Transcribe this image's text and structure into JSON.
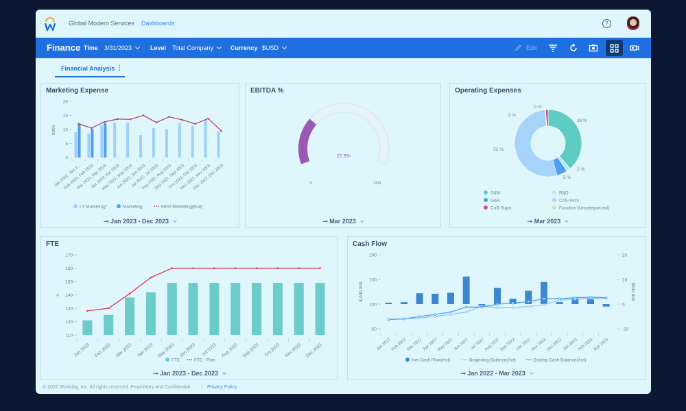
{
  "header": {
    "org": "Global Modern Services",
    "breadcrumb": "Dashboards",
    "help_icon": "?",
    "avatar": "user-avatar"
  },
  "toolbar": {
    "title": "Finance",
    "time_label": "Time",
    "time_value": "3/31/2023",
    "level_label": "Level",
    "level_value": "Total Company",
    "currency_label": "Currency",
    "currency_value": "$USD",
    "edit_label": "Edit",
    "icons": [
      "edit-icon",
      "filter-icon",
      "refresh-icon",
      "camera-icon",
      "grid-view-icon",
      "video-icon"
    ]
  },
  "tabs": [
    {
      "label": "Financial Analysis",
      "active": true
    }
  ],
  "colors": {
    "brand_blue": "#1f6fe0",
    "ly_marketing": "#9fd0f7",
    "marketing": "#4d9ef0",
    "budget_line": "#b9446a",
    "fte_bar": "#6ccbcb",
    "fte_plan": "#e0304a",
    "gauge": "#9b59b6",
    "cash_bar": "#3d86d0",
    "beginning_line": "#8cc4f5",
    "ending_line": "#4d9ef0"
  },
  "chart_data": [
    {
      "id": "marketing",
      "type": "bar",
      "title": "Marketing Expense",
      "ylabel": "$000",
      "ylim": [
        0,
        20
      ],
      "yticks": [
        0,
        5,
        10,
        15,
        20
      ],
      "categories": [
        "Jan 2022, Jan 2...",
        "Feb 2022, Feb 2023",
        "Mar 2022, Mar 2023",
        "Apr 2022, Apr 2023",
        "May 2022, May 2023",
        "Jun 2022, Jun 2023",
        "Jul 2022, Jul 2023",
        "Aug 2022, Aug 2023",
        "Sep 2022, Sep 2023",
        "Oct 2022, Oct 2023",
        "Nov 2022, Nov 2023",
        "Dec 2022, Dec 2023"
      ],
      "series": [
        {
          "name": "LY Marketing*",
          "kind": "bar",
          "values": [
            9,
            8.5,
            11.5,
            12.5,
            12.5,
            8,
            10.5,
            10,
            12.3,
            11.3,
            13.5,
            9.3
          ]
        },
        {
          "name": "Marketing",
          "kind": "bar",
          "values": [
            12.2,
            10.2,
            12.3,
            null,
            null,
            null,
            null,
            null,
            null,
            null,
            null,
            null
          ]
        },
        {
          "name": "6500 Marketing(Bud)",
          "kind": "line",
          "values": [
            12,
            10.5,
            12.7,
            13.7,
            13.6,
            15,
            12.5,
            14.5,
            13.4,
            12,
            13.9,
            9.5
          ]
        }
      ],
      "footer": "Jan 2023 - Dec 2023"
    },
    {
      "id": "ebitda",
      "type": "gauge",
      "title": "EBITDA %",
      "value": 27.9,
      "value_label": "27.9%",
      "min": 0,
      "max": 100,
      "min_label": "0",
      "max_label": "100",
      "footer": "Mar 2023"
    },
    {
      "id": "opex",
      "type": "pie",
      "title": "Operating Expenses",
      "slices": [
        {
          "name": "S&M",
          "value": 38,
          "label": "38 %",
          "color": "#5ecbc4"
        },
        {
          "name": "R&D",
          "value": 2,
          "label": "2 %",
          "color": "#b5ecf7"
        },
        {
          "name": "G&A",
          "value": 5,
          "label": "5 %",
          "color": "#4d9ef0"
        },
        {
          "name": "CoS-Svcs",
          "value": 52,
          "label": "52 %",
          "color": "#a5d3fa"
        },
        {
          "name": "Function (Uncategorized)",
          "value": 0.3,
          "label": "2 %",
          "color": "#e6d3b3"
        },
        {
          "name": "CoS-Suprt",
          "value": 1.2,
          "label": "0 %",
          "color": "#d24da0"
        }
      ],
      "legend": [
        "S&M",
        "R&D",
        "G&A",
        "CoS-Svcs",
        "CoS-Suprt",
        "Function (Uncategorized)"
      ],
      "footer": "Mar 2023"
    },
    {
      "id": "fte",
      "type": "bar",
      "title": "FTE",
      "ylabel": "#",
      "ylim": [
        110,
        170
      ],
      "yticks": [
        110,
        120,
        130,
        140,
        150,
        160,
        170
      ],
      "categories": [
        "Jan 2023",
        "Feb 2023",
        "Mar 2023",
        "Apr 2023",
        "May 2023",
        "Jun 2023",
        "Jul 2023",
        "Aug 2023",
        "Sep 2023",
        "Oct 2023",
        "Nov 2023",
        "Dec 2023"
      ],
      "series": [
        {
          "name": "FTE",
          "kind": "bar",
          "values": [
            121,
            125,
            138,
            142,
            149,
            149,
            149,
            149,
            149,
            149,
            149,
            149
          ]
        },
        {
          "name": "FTE - Plan",
          "kind": "line",
          "values": [
            128,
            130,
            141,
            153,
            160,
            160,
            160,
            160,
            160,
            160,
            160,
            160
          ]
        }
      ],
      "footer": "Jan 2023 - Dec 2023"
    },
    {
      "id": "cashflow",
      "type": "bar",
      "title": "Cash Flow",
      "ylabel": "$,000,000",
      "ylabel_right": "$000,000",
      "ylim": [
        50,
        200
      ],
      "yticks": [
        50,
        100,
        150,
        200
      ],
      "ylim_right": [
        -10,
        20
      ],
      "yticks_right": [
        -10,
        0,
        10,
        20
      ],
      "categories": [
        "Jan 2022",
        "Feb 2022",
        "Mar 2022",
        "Apr 2022",
        "May 2022",
        "Jun 2022",
        "Jul 2022",
        "Aug 2022",
        "Sep 2022",
        "Oct 2022",
        "Nov 2022",
        "Dec 2022",
        "Jan 2023",
        "Feb 2023",
        "Mar 2023"
      ],
      "series": [
        {
          "name": "Net Cash Flow(Act)",
          "kind": "bar",
          "values": [
            103,
            104,
            122,
            121,
            123,
            156,
            97,
            133,
            111,
            127,
            145,
            104,
            112,
            110,
            95
          ]
        },
        {
          "name": "Beginning Balance(Act)",
          "kind": "line",
          "values": [
            69,
            70,
            72,
            75,
            79,
            84,
            96,
            93,
            93,
            95,
            99,
            108,
            110,
            112,
            112
          ]
        },
        {
          "name": "Ending Cash Balance(Act)",
          "kind": "line",
          "values": [
            69,
            70,
            75,
            79,
            84,
            94,
            94,
            100,
            102,
            105,
            111,
            111,
            113,
            114,
            113
          ]
        }
      ],
      "footer": "Jan 2022 - Mar 2023"
    }
  ],
  "footer": {
    "copyright": "© 2022 Workday, Inc. All rights reserved. Proprietary and Confidential",
    "privacy": "Privacy Policy"
  }
}
